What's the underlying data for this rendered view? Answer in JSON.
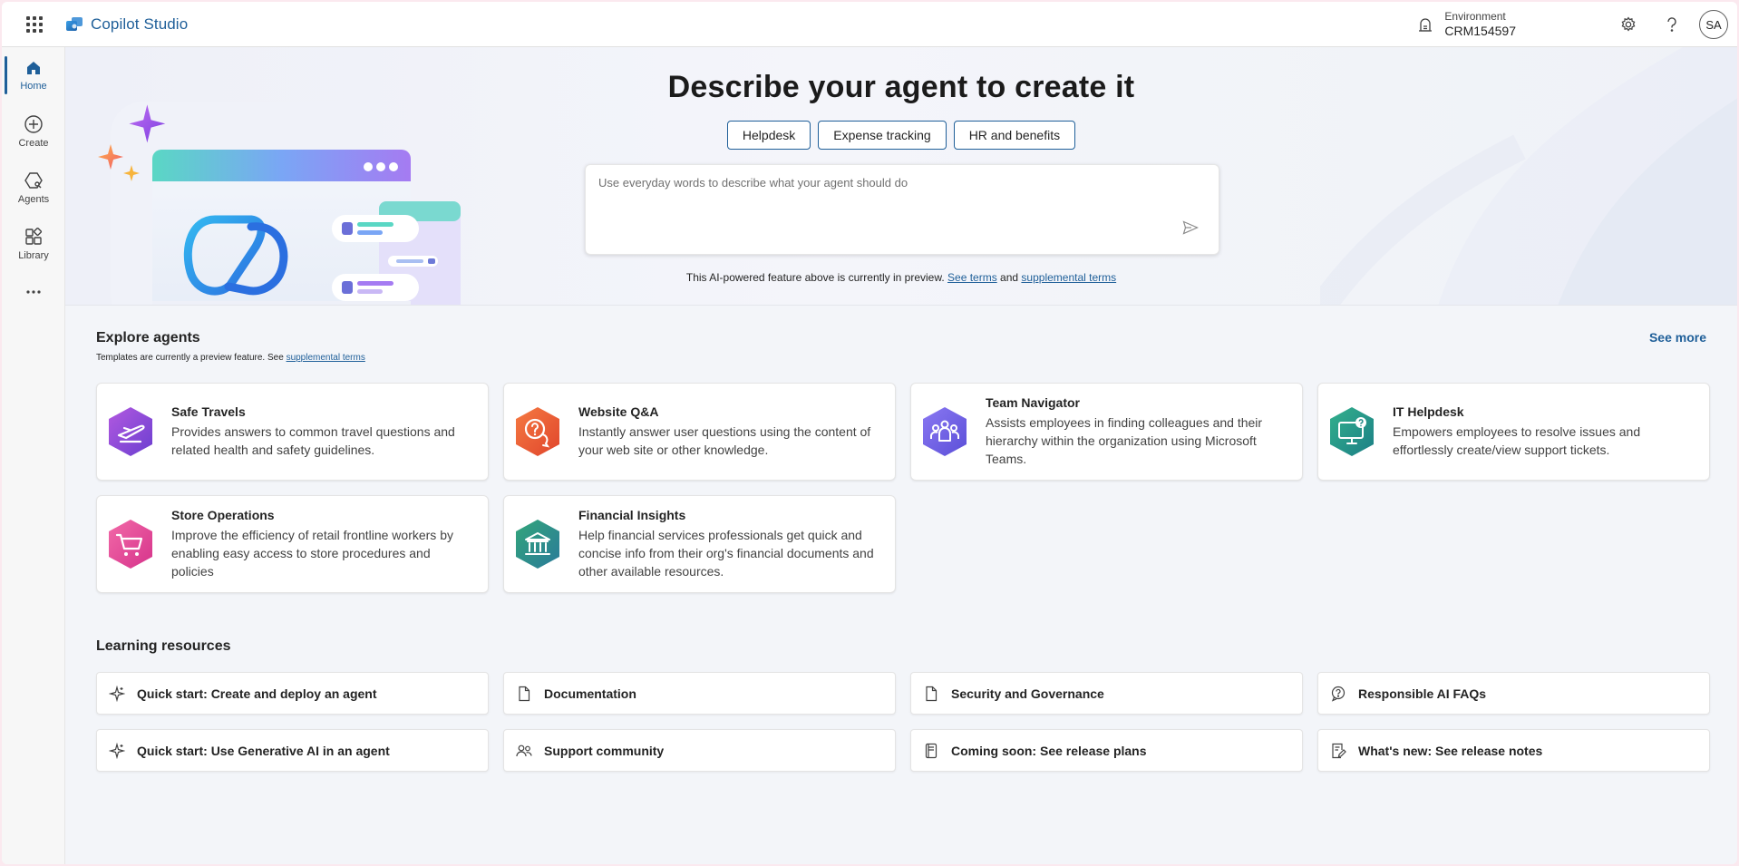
{
  "app": {
    "name": "Copilot Studio"
  },
  "environment": {
    "label": "Environment",
    "value": "CRM154597"
  },
  "user": {
    "initials": "SA"
  },
  "rail": {
    "items": [
      {
        "label": "Home",
        "icon": "home-icon"
      },
      {
        "label": "Create",
        "icon": "add-circle-icon"
      },
      {
        "label": "Agents",
        "icon": "agents-icon"
      },
      {
        "label": "Library",
        "icon": "library-icon"
      }
    ],
    "more": "..."
  },
  "hero": {
    "title": "Describe your agent to create it",
    "chips": [
      "Helpdesk",
      "Expense tracking",
      "HR and benefits"
    ],
    "placeholder": "Use everyday words to describe what your agent should do",
    "disclaimer_prefix": "This AI-powered feature above is currently in preview.",
    "see_terms": "See terms",
    "and": "and",
    "supplemental_terms": "supplemental terms"
  },
  "explore": {
    "title": "Explore agents",
    "subtitle_prefix": "Templates are currently a preview feature. See",
    "subtitle_link": "supplemental terms",
    "see_more": "See more",
    "cards": [
      {
        "title": "Safe Travels",
        "description": "Provides answers to common travel questions and related health and safety guidelines.",
        "icon": "airplane-icon",
        "color_a": "#a24ddb",
        "color_b": "#6b3fd0"
      },
      {
        "title": "Website Q&A",
        "description": "Instantly answer user questions using the content of your web site or other knowledge.",
        "icon": "question-chat-icon",
        "color_a": "#f26a3d",
        "color_b": "#e0452c"
      },
      {
        "title": "Team Navigator",
        "description": "Assists employees in finding colleagues and their hierarchy within the organization using Microsoft Teams.",
        "icon": "people-icon",
        "color_a": "#7c6cf0",
        "color_b": "#5b4fd8"
      },
      {
        "title": "IT Helpdesk",
        "description": "Empowers employees to resolve issues and effortlessly create/view support tickets.",
        "icon": "monitor-question-icon",
        "color_a": "#2aa58c",
        "color_b": "#1c7f86"
      },
      {
        "title": "Store Operations",
        "description": "Improve the efficiency of retail frontline workers by enabling easy access to store procedures and policies",
        "icon": "cart-icon",
        "color_a": "#ef5aa0",
        "color_b": "#d6338b"
      },
      {
        "title": "Financial Insights",
        "description": "Help financial services professionals get quick and concise info from their org's financial documents and other available resources.",
        "icon": "bank-icon",
        "color_a": "#2f9c7e",
        "color_b": "#2a7a9a"
      }
    ]
  },
  "learning": {
    "title": "Learning resources",
    "items": [
      {
        "label": "Quick start: Create and deploy an agent",
        "icon": "sparkle-icon"
      },
      {
        "label": "Documentation",
        "icon": "document-icon"
      },
      {
        "label": "Security and Governance",
        "icon": "document-icon"
      },
      {
        "label": "Responsible AI FAQs",
        "icon": "chat-question-icon"
      },
      {
        "label": "Quick start: Use Generative AI in an agent",
        "icon": "sparkle-icon"
      },
      {
        "label": "Support community",
        "icon": "people-community-icon"
      },
      {
        "label": "Coming soon: See release plans",
        "icon": "notebook-icon"
      },
      {
        "label": "What's new: See release notes",
        "icon": "notes-edit-icon"
      }
    ]
  }
}
